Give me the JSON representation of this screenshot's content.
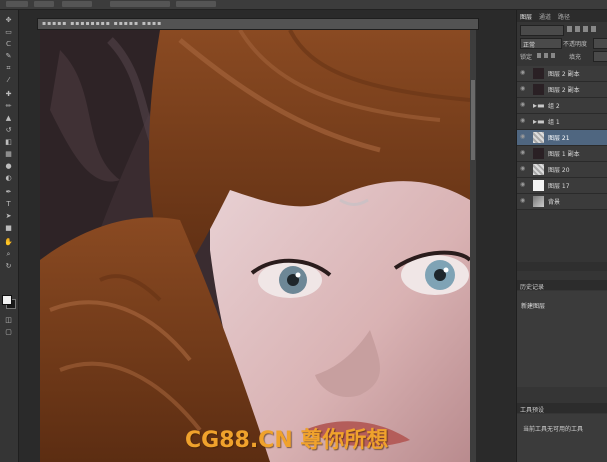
{
  "layers_panel": {
    "tabs": [
      "图层",
      "通道",
      "路径"
    ],
    "blend_mode": "正常",
    "opacity_label": "不透明度",
    "fill_label": "填充",
    "lock_label": "锁定",
    "layers": [
      {
        "name": "图层 2 副本",
        "selected": false,
        "thumb": "dark"
      },
      {
        "name": "图层 2 副本",
        "selected": false,
        "thumb": "dark"
      },
      {
        "name": "组 2",
        "selected": false,
        "thumb": "folder"
      },
      {
        "name": "组 1",
        "selected": false,
        "thumb": "folder"
      },
      {
        "name": "图层 21",
        "selected": true,
        "thumb": "trans"
      },
      {
        "name": "图层 1 副本",
        "selected": false,
        "thumb": "dark"
      },
      {
        "name": "图层 20",
        "selected": false,
        "thumb": "trans"
      },
      {
        "name": "图层 17",
        "selected": false,
        "thumb": "white"
      },
      {
        "name": "背景",
        "selected": false,
        "thumb": "photo"
      }
    ]
  },
  "history_panel": {
    "title": "历史记录",
    "item": "新建图层"
  },
  "tool_presets_panel": {
    "title": "工具预设",
    "message": "当前工具无可用的工具"
  },
  "watermark": "CG88.CN 尊你所想"
}
